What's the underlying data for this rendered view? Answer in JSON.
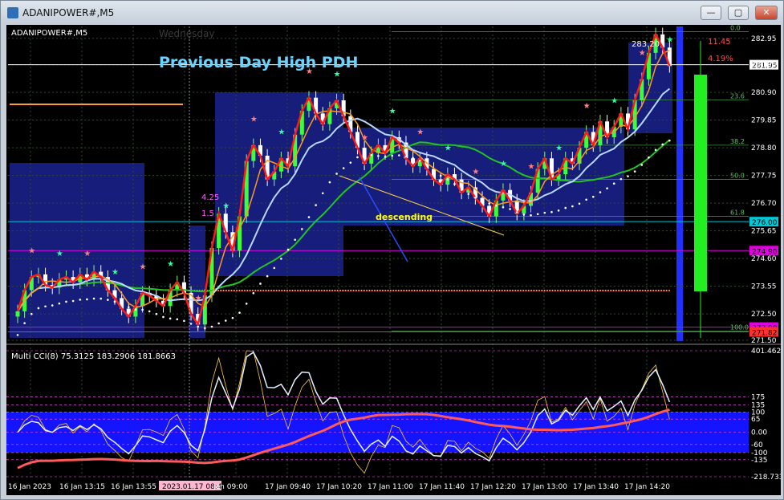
{
  "window": {
    "title": "ADANIPOWER#,M5",
    "min_label": "—",
    "max_label": "▢",
    "close_label": "✕"
  },
  "chart_data": {
    "type": "candlestick",
    "symbol_label": "ADANIPOWER#,M5",
    "day_label": "Wednesday",
    "title": "Previous Day High PDH",
    "annotation": "descending",
    "current_price_label": "281.95",
    "high_box_label": "283.20",
    "price_axis": {
      "ylim": [
        271.5,
        283.4
      ],
      "ticks": [
        "282.95",
        "281.95",
        "280.90",
        "279.85",
        "278.80",
        "277.75",
        "276.70",
        "275.65",
        "274.60",
        "273.55",
        "272.50",
        "271.50"
      ],
      "levels": [
        {
          "value": 281.95,
          "label": "281.95",
          "color": "#ffffff"
        },
        {
          "value": 276.0,
          "label": "276.00",
          "color": "#00c8d6"
        },
        {
          "value": 274.9,
          "label": "274.90",
          "color": "#e000e0"
        },
        {
          "value": 272.0,
          "label": "272.00",
          "color": "#e000e0"
        },
        {
          "value": 271.82,
          "label": "271.82",
          "color": "#ff3030"
        }
      ]
    },
    "fib_levels": [
      {
        "value": 283.2,
        "label": "0.0"
      },
      {
        "value": 280.62,
        "label": "23.6"
      },
      {
        "value": 278.9,
        "label": "38.2"
      },
      {
        "value": 277.6,
        "label": "50.0"
      },
      {
        "value": 276.2,
        "label": "61.8"
      },
      {
        "value": 271.85,
        "label": "100.0"
      }
    ],
    "right_annotations": [
      {
        "label": "11.45",
        "color": "#ff4d4d"
      },
      {
        "label": "4.19%",
        "color": "#ff4d4d"
      }
    ],
    "left_annotations": [
      {
        "label": "4.25",
        "color": "#ff60ff"
      },
      {
        "label": "1.5",
        "color": "#ff60ff"
      }
    ],
    "time_axis": [
      "16 Jan 2023",
      "16 Jan 13:15",
      "16 Jan 13:55",
      "2023.01.17 08:40",
      "Jan 09:00",
      "17 Jan 09:40",
      "17 Jan 10:20",
      "17 Jan 11:00",
      "17 Jan 11:40",
      "17 Jan 12:20",
      "17 Jan 13:00",
      "17 Jan 13:40",
      "17 Jan 14:20"
    ],
    "closes": [
      272.6,
      273.4,
      273.9,
      274.0,
      273.6,
      273.5,
      273.8,
      273.9,
      273.7,
      274.0,
      273.8,
      274.1,
      273.9,
      273.4,
      273.1,
      272.7,
      272.4,
      272.8,
      273.3,
      273.2,
      273.0,
      272.8,
      273.4,
      273.7,
      273.3,
      272.5,
      272.1,
      273.2,
      275.0,
      276.3,
      275.6,
      274.9,
      276.2,
      278.3,
      278.9,
      278.5,
      277.6,
      277.9,
      278.4,
      278.1,
      279.3,
      280.2,
      280.7,
      280.1,
      279.7,
      280.3,
      280.6,
      280.0,
      279.4,
      278.8,
      278.2,
      278.6,
      278.9,
      278.6,
      279.2,
      279.0,
      278.4,
      278.1,
      278.4,
      278.0,
      277.6,
      277.4,
      277.8,
      277.6,
      277.1,
      277.3,
      276.9,
      276.6,
      276.2,
      276.8,
      277.2,
      276.8,
      276.3,
      276.6,
      277.1,
      278.0,
      278.4,
      277.6,
      277.8,
      278.4,
      278.2,
      278.8,
      279.4,
      278.9,
      279.8,
      279.2,
      279.6,
      280.1,
      279.5,
      280.6,
      281.4,
      282.4,
      283.1,
      282.6,
      281.9
    ],
    "multi_cci": {
      "label": "Multi CCI(8) 75.3125 183.2906 181.8663",
      "ylim": [
        -218.733,
        401.462
      ],
      "ticks": [
        "401.462",
        "175",
        "135",
        "100",
        "65",
        "0.00",
        "-60",
        "-100",
        "-135",
        "-218.733"
      ]
    },
    "grid": true
  }
}
